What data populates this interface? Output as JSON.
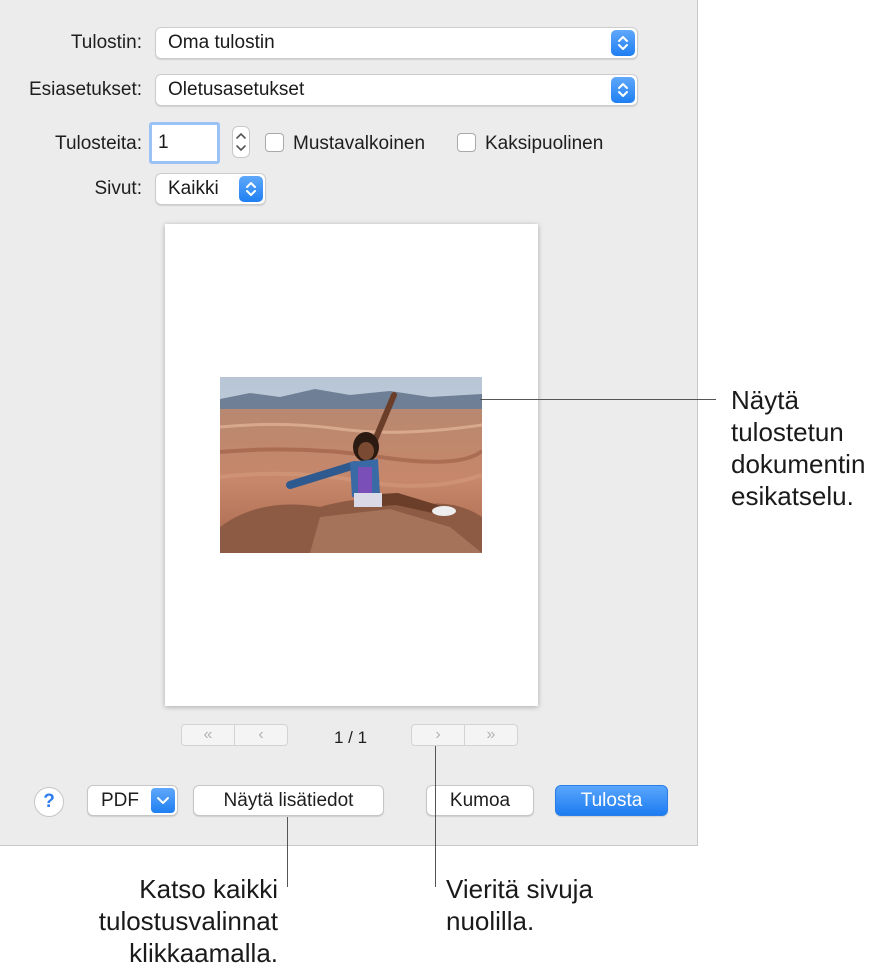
{
  "dialog": {
    "printer": {
      "label": "Tulostin:",
      "value": "Oma tulostin"
    },
    "presets": {
      "label": "Esiasetukset:",
      "value": "Oletusasetukset"
    },
    "copies": {
      "label": "Tulosteita:",
      "value": "1"
    },
    "bw": {
      "label": "Mustavalkoinen",
      "checked": false
    },
    "duplex": {
      "label": "Kaksipuolinen",
      "checked": false
    },
    "pages": {
      "label": "Sivut:",
      "value": "Kaikki"
    }
  },
  "preview": {
    "page_indicator": "1 / 1",
    "nav_icons": {
      "first": "double-chevron-left-icon",
      "prev": "chevron-left-icon",
      "next": "chevron-right-icon",
      "last": "double-chevron-right-icon"
    },
    "photo": "woman-posing-on-canyon-rock"
  },
  "buttons": {
    "help": "?",
    "pdf": "PDF",
    "show_details": "Näytä lisätiedot",
    "cancel": "Kumoa",
    "print": "Tulosta"
  },
  "callouts": {
    "preview": [
      "Näytä",
      "tulostetun",
      "dokumentin",
      "esikatselu."
    ],
    "details": [
      "Katso kaikki",
      "tulostusvalinnat",
      "klikkaamalla."
    ],
    "arrows": [
      "Vieritä sivuja",
      "nuolilla."
    ]
  },
  "colors": {
    "accent": "#1f7ff2",
    "dialog_bg": "#ececec"
  }
}
